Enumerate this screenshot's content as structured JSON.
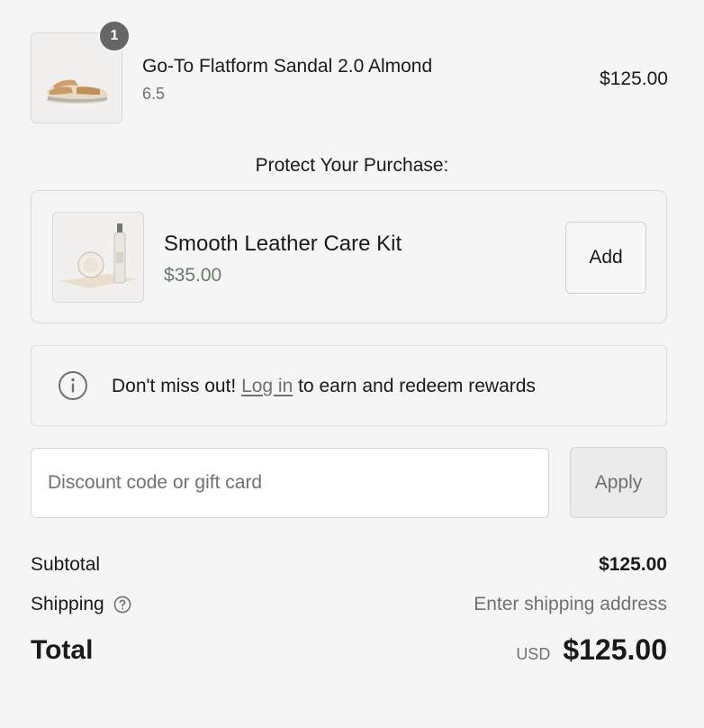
{
  "line_item": {
    "quantity": "1",
    "title": "Go-To Flatform Sandal 2.0 Almond",
    "variant": "6.5",
    "price": "$125.00",
    "image_icon": "sandal-product-image"
  },
  "protect": {
    "heading": "Protect Your Purchase:",
    "product_title": "Smooth Leather Care Kit",
    "product_price": "$35.00",
    "add_label": "Add",
    "image_icon": "leather-care-kit-image"
  },
  "rewards": {
    "prefix": "Don't miss out! ",
    "link": "Log in",
    "suffix": " to earn and redeem rewards",
    "icon": "info-icon"
  },
  "discount": {
    "placeholder": "Discount code or gift card",
    "value": "",
    "apply_label": "Apply"
  },
  "totals": {
    "subtotal_label": "Subtotal",
    "subtotal_value": "$125.00",
    "shipping_label": "Shipping",
    "shipping_value": "Enter shipping address",
    "total_label": "Total",
    "currency": "USD",
    "total_value": "$125.00"
  },
  "colors": {
    "background": "#f5f5f5",
    "text": "#1a1a1a",
    "muted": "#707070",
    "price_green": "#6b7b6b",
    "badge": "#666666"
  }
}
